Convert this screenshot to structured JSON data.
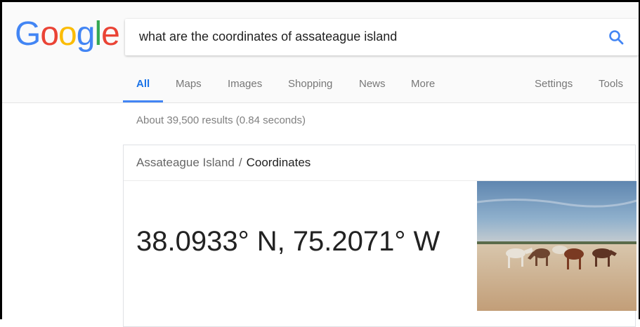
{
  "logo": {
    "text": "Google",
    "letters": [
      {
        "ch": "G",
        "color": "#4285f4"
      },
      {
        "ch": "o",
        "color": "#ea4335"
      },
      {
        "ch": "o",
        "color": "#fbbc05"
      },
      {
        "ch": "g",
        "color": "#4285f4"
      },
      {
        "ch": "l",
        "color": "#34a853"
      },
      {
        "ch": "e",
        "color": "#ea4335"
      }
    ]
  },
  "search": {
    "query": "what are the coordinates of assateague island",
    "icon": "search-icon"
  },
  "tabs": {
    "all": "All",
    "maps": "Maps",
    "images": "Images",
    "shopping": "Shopping",
    "news": "News",
    "more": "More",
    "settings": "Settings",
    "tools": "Tools"
  },
  "results": {
    "stats": "About 39,500 results (0.84 seconds)"
  },
  "answer_card": {
    "entity": "Assateague Island",
    "separator": "/",
    "attribute": "Coordinates",
    "value": "38.0933° N, 75.2071° W",
    "image": "wild-horses-on-beach"
  },
  "colors": {
    "accent": "#4285f4",
    "tab_active": "#1a73e8"
  }
}
